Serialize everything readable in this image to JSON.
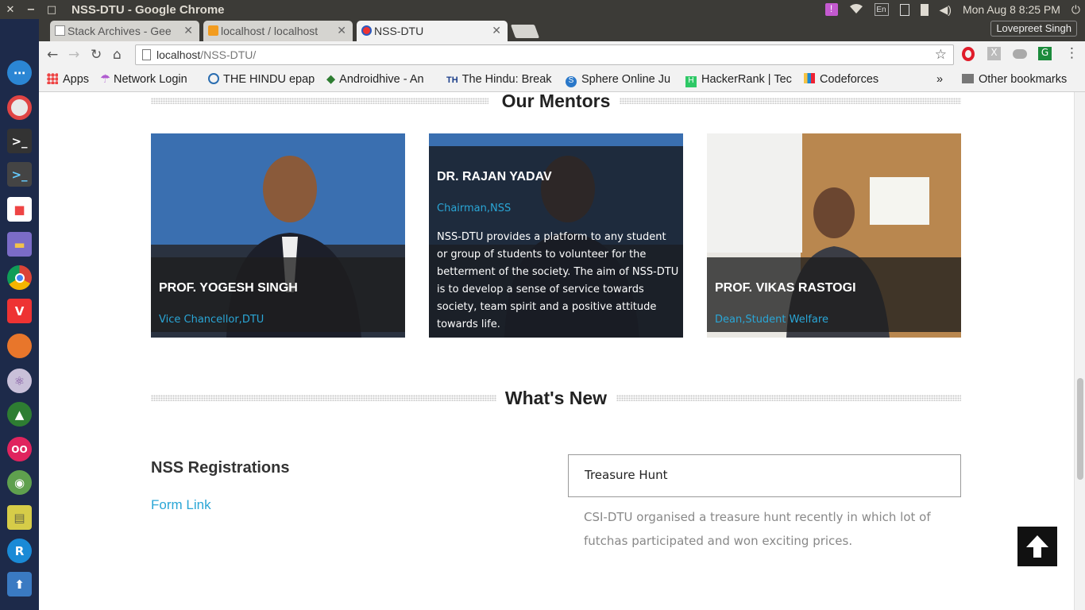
{
  "window": {
    "title": "NSS-DTU - Google Chrome",
    "close": "✕",
    "minimize": "−",
    "maximize": "□"
  },
  "tray": {
    "keyboard": "En",
    "datetime": "Mon Aug  8  8:25 PM"
  },
  "tabs": [
    {
      "label": "Stack Archives - Gee"
    },
    {
      "label": "localhost / localhost"
    },
    {
      "label": "NSS-DTU"
    }
  ],
  "profile": "Lovepreet Singh",
  "address": {
    "host": "localhost",
    "path": "/NSS-DTU/"
  },
  "bookmarks": [
    {
      "label": "Apps"
    },
    {
      "label": "Network Login"
    },
    {
      "label": "THE HINDU epap"
    },
    {
      "label": "Androidhive - An"
    },
    {
      "label": "The Hindu: Break"
    },
    {
      "label": "Sphere Online Ju"
    },
    {
      "label": "HackerRank | Tec"
    },
    {
      "label": "Codeforces"
    },
    {
      "label": "»"
    },
    {
      "label": "Other bookmarks"
    }
  ],
  "bookmark_icons": {
    "th": "TH",
    "hr": "H",
    "sphere": "S"
  },
  "mentors_heading": "Our Mentors",
  "mentors": [
    {
      "name": "PROF. YOGESH SINGH",
      "role": "Vice Chancellor,DTU"
    },
    {
      "name": "DR. RAJAN YADAV",
      "role": "Chairman,NSS",
      "description": "NSS-DTU provides a platform to any student or group of students to volunteer for the betterment of the society. The aim of NSS-DTU is to develop a sense of service towards society, team spirit and a positive attitude towards life."
    },
    {
      "name": "PROF. VIKAS RASTOGI",
      "role": "Dean,Student Welfare"
    }
  ],
  "whats_new_heading": "What's New",
  "registrations": {
    "title": "NSS Registrations",
    "link": "Form Link"
  },
  "news": {
    "title": "Treasure Hunt",
    "text": "CSI-DTU organised a treasure hunt recently in which lot of futchas participated and won exciting prices."
  },
  "colors": {
    "accent": "#2aa6d6",
    "launcher": "#1d2a4a"
  }
}
